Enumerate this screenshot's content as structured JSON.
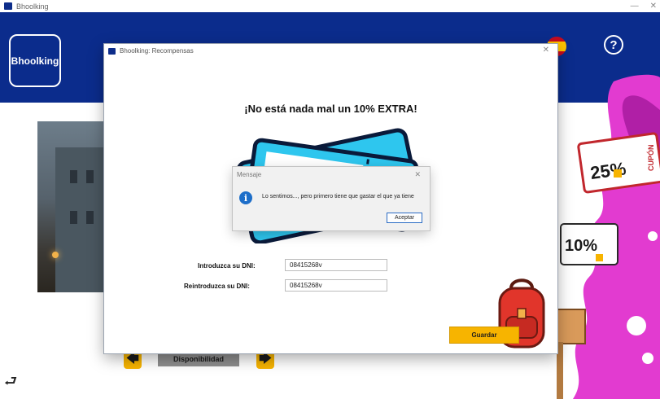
{
  "window": {
    "title": "Bhoolking",
    "minimize_glyph": "—",
    "close_glyph": "✕"
  },
  "header": {
    "logo_text": "Bhoolking",
    "help_glyph": "?",
    "flag": "spain-flag-icon"
  },
  "page": {
    "availability_label": "Disponibilidad",
    "prev_glyph": "🡄",
    "next_glyph": "🡆",
    "logout_glyph": "⮐"
  },
  "dialog": {
    "title": "Bhoolking: Recompensas",
    "close_glyph": "✕",
    "headline": "¡No está nada mal un 10% EXTRA!",
    "dni_label": "Introduzca su DNI:",
    "dni_value": "08415268v",
    "dni_confirm_label": "Reintroduzca su DNI:",
    "dni_confirm_value": "08415268v",
    "save_label": "Guardar"
  },
  "message": {
    "title": "Mensaje",
    "close_glyph": "✕",
    "icon_glyph": "i",
    "text": "Lo sentimos..., pero primero tiene que gastar el que ya tiene",
    "ok_label": "Aceptar"
  },
  "deco": {
    "coupon_top_text": "25%",
    "coupon_side_text": "CUPÓN",
    "coupon_bottom_text": "10%"
  },
  "colors": {
    "brand_blue": "#0b2c8c",
    "accent_yellow": "#f7b400",
    "info_blue": "#1d6ec9",
    "splash_pink": "#e23bd0"
  }
}
